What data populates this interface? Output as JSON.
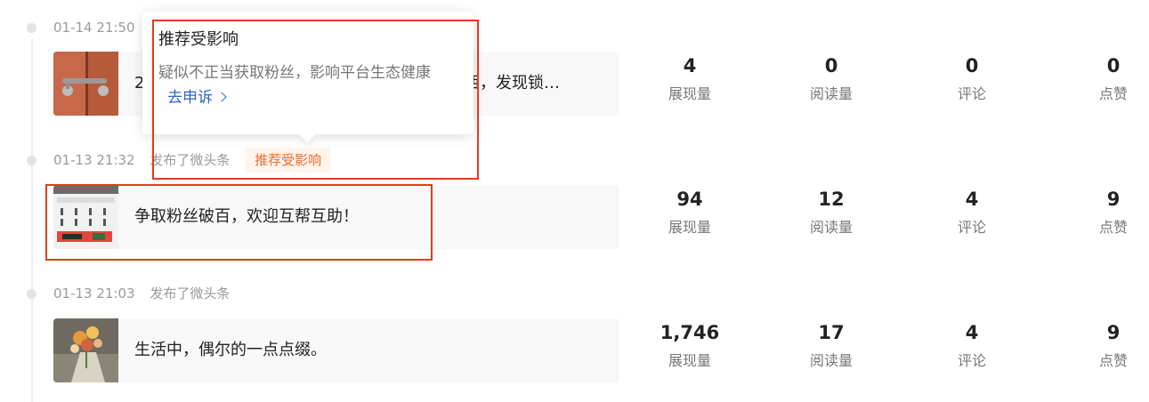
{
  "colors": {
    "accent_link": "#2f66c9",
    "badge_text": "#f06a2b",
    "annotation_red": "#e5391e"
  },
  "stat_labels": {
    "views": "展现量",
    "reads": "阅读量",
    "comments": "评论",
    "likes": "点赞"
  },
  "posts": [
    {
      "time": "01-14 21:50",
      "action": "",
      "text_visible_start": "2",
      "text_visible_end": "西，发现锁…",
      "thumbnail": "door-lock-photo",
      "stats": {
        "views": "4",
        "reads": "0",
        "comments": "0",
        "likes": "0"
      }
    },
    {
      "time": "01-13 21:32",
      "action": "发布了微头条",
      "badge": "推荐受影响",
      "text": "争取粉丝破百，欢迎互帮互助！",
      "thumbnail": "screenshot-thumbnail",
      "stats": {
        "views": "94",
        "reads": "12",
        "comments": "4",
        "likes": "9"
      }
    },
    {
      "time": "01-13 21:03",
      "action": "发布了微头条",
      "text": "生活中，偶尔的一点点缀。",
      "thumbnail": "flowers-photo",
      "stats": {
        "views": "1,746",
        "reads": "17",
        "comments": "4",
        "likes": "9"
      }
    }
  ],
  "tooltip": {
    "title": "推荐受影响",
    "description": "疑似不正当获取粉丝，影响平台生态健康",
    "appeal_label": "去申诉"
  }
}
